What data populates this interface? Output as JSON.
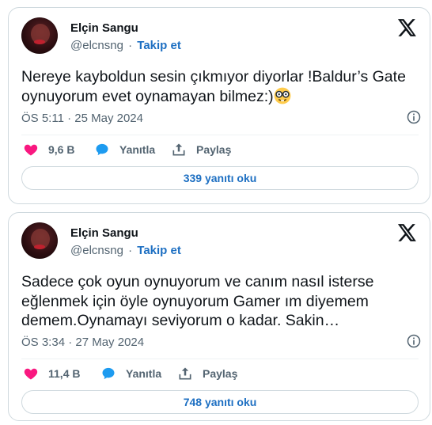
{
  "tweets": [
    {
      "author": {
        "name": "Elçin Sangu",
        "handle": "@elcnsng",
        "follow_label": "Takip et",
        "separator": "·"
      },
      "text": "Nereye kayboldun sesin çıkmıyor diyorlar !Baldur’s Gate oynuyorum evet oynamayan bilmez:)",
      "emoji": "nerd-face-emoji",
      "timestamp": "ÖS 5:11 · 25 May 2024",
      "actions": {
        "likes": "9,6 B",
        "reply_label": "Yanıtla",
        "share_label": "Paylaş"
      },
      "read_replies_label": "339 yanıtı oku"
    },
    {
      "author": {
        "name": "Elçin Sangu",
        "handle": "@elcnsng",
        "follow_label": "Takip et",
        "separator": "·"
      },
      "text": "Sadece çok oyun oynuyorum ve canım nasıl isterse eğlenmek için öyle oynuyorum Gamer ım diyemem demem.Oynamayı seviyorum o kadar. Sakin…",
      "timestamp": "ÖS 3:34 · 27 May 2024",
      "actions": {
        "likes": "11,4 B",
        "reply_label": "Yanıtla",
        "share_label": "Paylaş"
      },
      "read_replies_label": "748 yanıtı oku"
    }
  ],
  "colors": {
    "like": "#f91880",
    "reply": "#1d9bf0",
    "link": "#1d6fc2",
    "muted": "#536471",
    "border": "#cfd9de"
  },
  "icons": [
    "x-logo-icon",
    "info-icon",
    "heart-icon",
    "reply-bubble-icon",
    "share-icon"
  ]
}
